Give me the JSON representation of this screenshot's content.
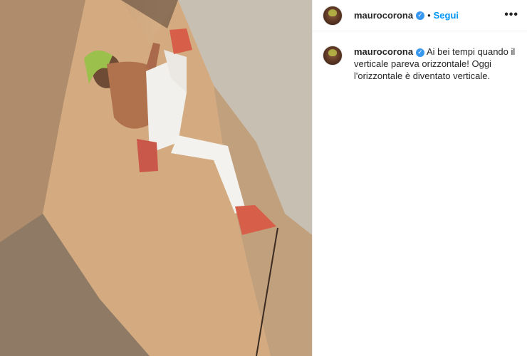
{
  "post": {
    "username": "maurocorona",
    "follow_label": "Segui",
    "separator": "•",
    "more_label": "•••",
    "verified_glyph": "✓",
    "caption": "Ai bei tempi quando il verticale pareva orizzontale! Oggi l'orizzontale è diventato verticale.",
    "photo_icon": "climber-photo",
    "colors": {
      "link": "#0095f6",
      "verified": "#3897f0"
    }
  }
}
